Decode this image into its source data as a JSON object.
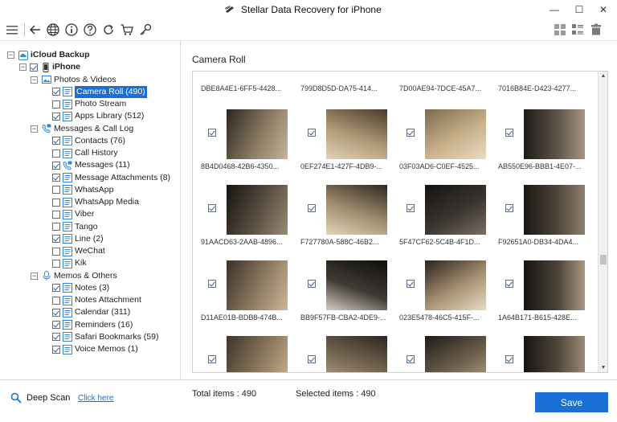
{
  "app": {
    "title": "Stellar Data Recovery for iPhone",
    "window_controls": [
      "—",
      "☐",
      "✕"
    ]
  },
  "toolbar": {
    "left_icons": [
      "menu-icon",
      "back-arrow-icon",
      "globe-icon",
      "info-icon",
      "help-icon",
      "refresh-icon",
      "cart-icon",
      "key-icon"
    ],
    "right_icons": [
      "grid-view-icon",
      "list-view-icon",
      "trash-icon"
    ]
  },
  "tree": {
    "root": "iCloud Backup",
    "device": "iPhone",
    "groups": [
      {
        "label": "Photos & Videos",
        "items": [
          {
            "label": "Camera Roll (490)",
            "checked": true,
            "selected": true
          },
          {
            "label": "Photo Stream",
            "checked": false
          },
          {
            "label": "Apps Library (512)",
            "checked": true
          }
        ]
      },
      {
        "label": "Messages & Call Log",
        "items": [
          {
            "label": "Contacts (76)",
            "checked": true
          },
          {
            "label": "Call History",
            "checked": false
          },
          {
            "label": "Messages (11)",
            "checked": true
          },
          {
            "label": "Message Attachments (8)",
            "checked": true
          },
          {
            "label": "WhatsApp",
            "checked": false
          },
          {
            "label": "WhatsApp Media",
            "checked": false
          },
          {
            "label": "Viber",
            "checked": false
          },
          {
            "label": "Tango",
            "checked": false
          },
          {
            "label": "Line (2)",
            "checked": true
          },
          {
            "label": "WeChat",
            "checked": false
          },
          {
            "label": "Kik",
            "checked": false
          }
        ]
      },
      {
        "label": "Memos & Others",
        "items": [
          {
            "label": "Notes (3)",
            "checked": true
          },
          {
            "label": "Notes Attachment",
            "checked": false
          },
          {
            "label": "Calendar (311)",
            "checked": true
          },
          {
            "label": "Reminders (16)",
            "checked": true
          },
          {
            "label": "Safari Bookmarks (59)",
            "checked": true
          },
          {
            "label": "Voice Memos (1)",
            "checked": true
          }
        ]
      }
    ]
  },
  "main": {
    "section_title": "Camera Roll",
    "top_row_names": [
      "DBE8A4E1-6FF5-4428...",
      "799D8D5D-DA75-414...",
      "7D00AE94-7DCE-45A7...",
      "7016B84E-D423-4277..."
    ],
    "thumbnails": [
      {
        "name": "8B4D0468-42B6-4350...",
        "checked": true
      },
      {
        "name": "0EF274E1-427F-4DB9-...",
        "checked": true
      },
      {
        "name": "03F03AD6-C0EF-4525...",
        "checked": true
      },
      {
        "name": "AB550E96-BBB1-4E07-...",
        "checked": true
      },
      {
        "name": "91AACD63-2AAB-4896...",
        "checked": true
      },
      {
        "name": "F727780A-588C-46B2...",
        "checked": true
      },
      {
        "name": "5F47CF62-5C4B-4F1D...",
        "checked": true
      },
      {
        "name": "F92651A0-DB34-4DA4...",
        "checked": true
      },
      {
        "name": "D11AE01B-BDB8-474B...",
        "checked": true
      },
      {
        "name": "BB9F57FB-CBA2-4DE9-...",
        "checked": true
      },
      {
        "name": "023E5478-46C5-415F-...",
        "checked": true
      },
      {
        "name": "1A64B171-B615-428E...",
        "checked": true
      },
      {
        "name": "",
        "checked": true
      },
      {
        "name": "",
        "checked": true
      },
      {
        "name": "",
        "checked": true
      },
      {
        "name": "",
        "checked": true
      }
    ]
  },
  "status": {
    "deep_scan_label": "Deep Scan",
    "click_here": "Click here",
    "total_items": "Total items : 490",
    "selected_items": "Selected items : 490",
    "save_label": "Save"
  },
  "colors": {
    "accent": "#1a6fd6",
    "folder_icon": "#2f86d8"
  }
}
